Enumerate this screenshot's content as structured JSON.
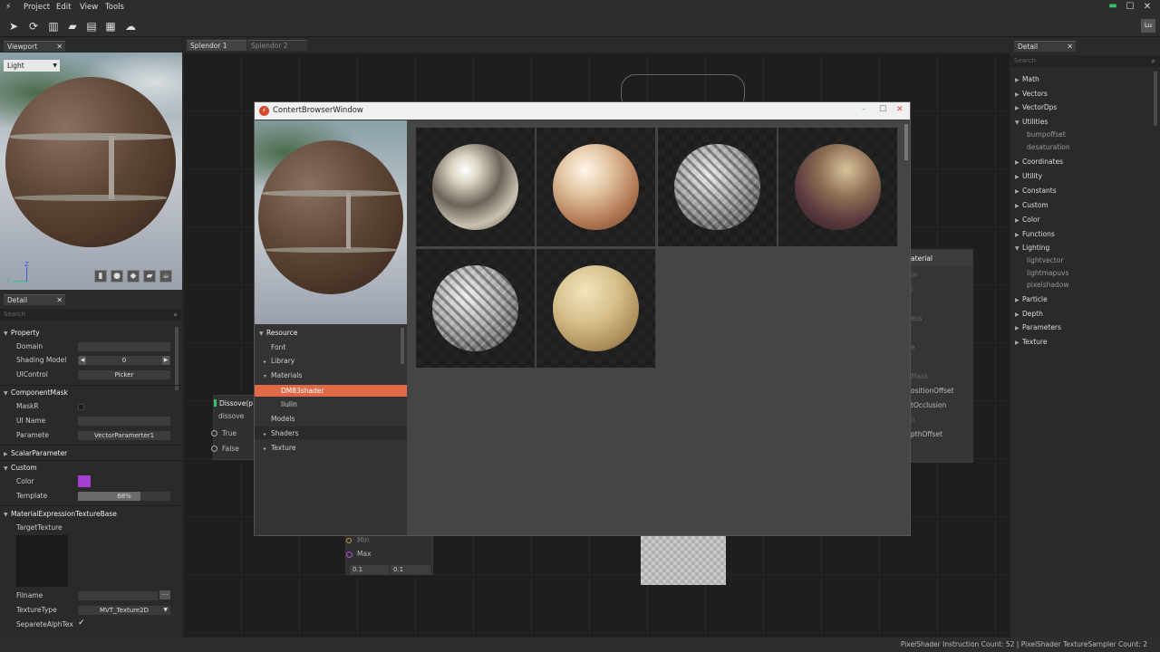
{
  "menubar": {
    "items": [
      "Project",
      "Edit",
      "View",
      "Tools"
    ],
    "window_controls": [
      "minimize-icon",
      "maximize-icon",
      "close-icon"
    ]
  },
  "toolbar": {
    "icons": [
      "send-icon",
      "refresh-icon",
      "chart-icon",
      "folder-icon",
      "clipboard-icon",
      "notepad-icon",
      "cloud-icon"
    ],
    "user_badge": "Lu"
  },
  "viewport": {
    "tab": "Viewport",
    "mode": "Light",
    "axis_y": "Y",
    "axis_z": "Z",
    "buttons": [
      "cylinder-icon",
      "sphere-icon",
      "plane-icon",
      "cube-icon",
      "teapot-icon"
    ]
  },
  "left_detail": {
    "tab": "Detail",
    "search_placeholder": "Search",
    "sections": {
      "property": {
        "header": "Property",
        "domain_label": "Domain",
        "shading_label": "Shading Model",
        "shading_value": "0",
        "uicontrol_label": "UIControl",
        "uicontrol_value": "Picker"
      },
      "component_mask": {
        "header": "ComponentMask",
        "maskr_label": "MaskR",
        "uiname_label": "UI Name",
        "param_label": "Paramete",
        "param_value": "VectorParamerter1"
      },
      "scalar": {
        "header": "ScalarParameter"
      },
      "custom": {
        "header": "Custom",
        "color_label": "Color",
        "color_value": "#a63fd1",
        "template_label": "Template",
        "template_value": "68%",
        "template_fraction": 0.68
      },
      "material_texture": {
        "header": "MaterialExpressionTextureBase",
        "target_label": "TargetTexture",
        "filename_label": "Filname",
        "filename_button": "···",
        "texturetype_label": "TextureType",
        "texturetype_value": "MVT_Texture2D",
        "separate_label": "SeparetеAlphTex",
        "separate_check": "✓"
      }
    }
  },
  "doc_tabs": [
    "Splendor  1",
    "Splendor  2"
  ],
  "nodes": {
    "dissolve": {
      "title": "Dissove(p",
      "subtitle": "dissove",
      "ports": [
        "True",
        "False"
      ]
    },
    "minmax": {
      "ports": [
        "Min",
        "Max"
      ],
      "values": [
        "0.1",
        "0.1"
      ]
    },
    "material": {
      "title": "aterial",
      "ports": [
        "or",
        "r",
        "ess",
        "e",
        "Mask",
        "ositionOffset",
        "tOcclusion",
        "n",
        "pthOffset"
      ]
    }
  },
  "content_browser": {
    "title": "ContertBrowserWindow",
    "controls": [
      "minimize-icon",
      "maximize-icon",
      "close-icon"
    ],
    "tree": {
      "root": "Resource",
      "items": [
        {
          "label": "Font",
          "level": 1,
          "arrow": ""
        },
        {
          "label": "Library",
          "level": 1,
          "arrow": "▸"
        },
        {
          "label": "Materials",
          "level": 1,
          "arrow": "▾"
        },
        {
          "label": "DM83shader",
          "level": 2,
          "arrow": "",
          "selected": true
        },
        {
          "label": "liulin",
          "level": 2,
          "arrow": ""
        },
        {
          "label": "Models",
          "level": 1,
          "arrow": ""
        },
        {
          "label": "Shaders",
          "level": 1,
          "arrow": "▸"
        },
        {
          "label": "Texture",
          "level": 1,
          "arrow": "▸"
        }
      ]
    },
    "materials": [
      "chrome",
      "pearl",
      "woven-metal",
      "leather",
      "woven-metal-2",
      "sandstone"
    ]
  },
  "right_detail": {
    "tab": "Detail",
    "search_placeholder": "Search",
    "items": [
      {
        "label": "Math",
        "open": false
      },
      {
        "label": "Vectors",
        "open": false
      },
      {
        "label": "VectorDps",
        "open": false
      },
      {
        "label": "Utilities",
        "open": true,
        "children": [
          "bumpoffset",
          "desaturation"
        ]
      },
      {
        "label": "Coordinates",
        "open": false
      },
      {
        "label": "Utility",
        "open": false
      },
      {
        "label": "Constants",
        "open": false
      },
      {
        "label": "Custom",
        "open": false
      },
      {
        "label": "Color",
        "open": false
      },
      {
        "label": "Functions",
        "open": false
      },
      {
        "label": "Lighting",
        "open": true,
        "children": [
          "lightvector",
          "lightmapuvs",
          "pixelshadow"
        ]
      },
      {
        "label": "Particle",
        "open": false
      },
      {
        "label": "Depth",
        "open": false
      },
      {
        "label": "Parameters",
        "open": false
      },
      {
        "label": "Texture",
        "open": false
      }
    ]
  },
  "status": {
    "text": "PixelShader Instruction Count: 52 | PixelShader TextureSampler Count: 2"
  },
  "colors": {
    "accent": "#e06a48",
    "close": "#e04040",
    "minimize": "#34c26a"
  }
}
